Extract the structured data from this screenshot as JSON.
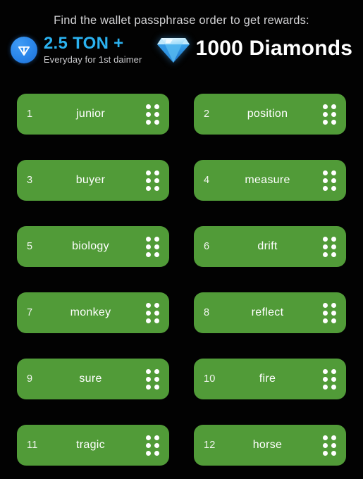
{
  "header": {
    "headline": "Find the wallet passphrase order to get rewards:",
    "ton_reward": {
      "icon": "ton-logo-icon",
      "amount": "2.5 TON +",
      "subtitle": "Everyday for 1st daimer",
      "color": "#2bb2f0"
    },
    "diamond_reward": {
      "icon": "diamond-icon",
      "amount": "1000 Diamonds",
      "color": "#ffffff"
    }
  },
  "colors": {
    "background": "#020202",
    "tile": "#519b38",
    "tile_text": "#ffffff",
    "headline": "#d2d2d4",
    "ton_blue": "#2bb2f0"
  },
  "word_list": {
    "handle_icon": "drag-handle-icon",
    "items": [
      {
        "index": "1",
        "word": "junior"
      },
      {
        "index": "2",
        "word": "position"
      },
      {
        "index": "3",
        "word": "buyer"
      },
      {
        "index": "4",
        "word": "measure"
      },
      {
        "index": "5",
        "word": "biology"
      },
      {
        "index": "6",
        "word": "drift"
      },
      {
        "index": "7",
        "word": "monkey"
      },
      {
        "index": "8",
        "word": "reflect"
      },
      {
        "index": "9",
        "word": "sure"
      },
      {
        "index": "10",
        "word": "fire"
      },
      {
        "index": "11",
        "word": "tragic"
      },
      {
        "index": "12",
        "word": "horse"
      }
    ]
  }
}
